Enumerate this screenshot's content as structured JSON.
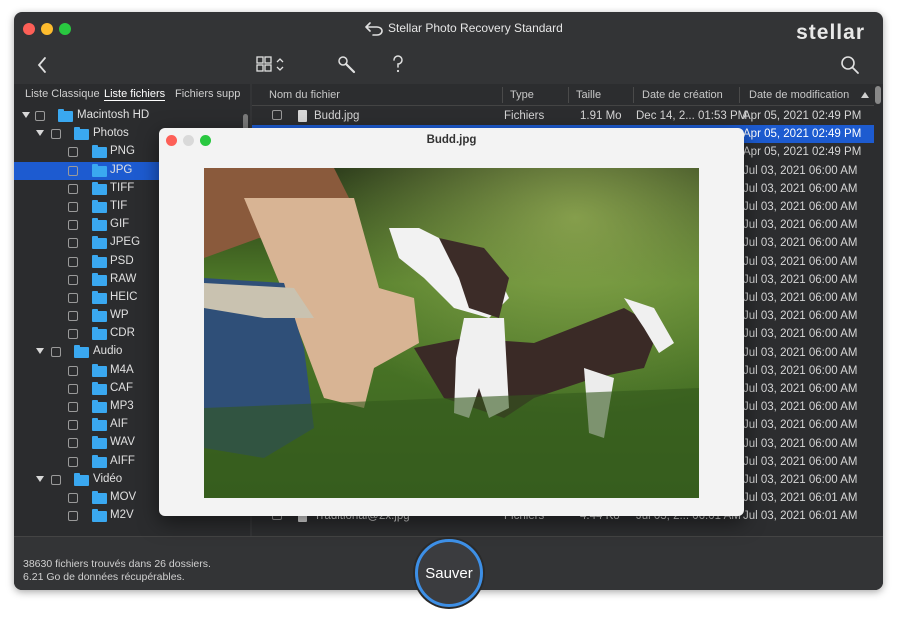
{
  "window": {
    "title": "Stellar Photo Recovery Standard",
    "logo": "stellar"
  },
  "sidebar": {
    "tabs": [
      "Liste Classique",
      "Liste fichiers",
      "Fichiers supp"
    ],
    "active_tab": 1,
    "tree": [
      {
        "label": "Macintosh HD",
        "level": 0,
        "expanded": true
      },
      {
        "label": "Photos",
        "level": 1,
        "expanded": true
      },
      {
        "label": "PNG",
        "level": 2
      },
      {
        "label": "JPG",
        "level": 2,
        "selected": true
      },
      {
        "label": "TIFF",
        "level": 2
      },
      {
        "label": "TIF",
        "level": 2
      },
      {
        "label": "GIF",
        "level": 2
      },
      {
        "label": "JPEG",
        "level": 2
      },
      {
        "label": "PSD",
        "level": 2
      },
      {
        "label": "RAW",
        "level": 2
      },
      {
        "label": "HEIC",
        "level": 2
      },
      {
        "label": "WP",
        "level": 2
      },
      {
        "label": "CDR",
        "level": 2
      },
      {
        "label": "Audio",
        "level": 1,
        "expanded": true
      },
      {
        "label": "M4A",
        "level": 2
      },
      {
        "label": "CAF",
        "level": 2
      },
      {
        "label": "MP3",
        "level": 2
      },
      {
        "label": "AIF",
        "level": 2
      },
      {
        "label": "WAV",
        "level": 2
      },
      {
        "label": "AIFF",
        "level": 2
      },
      {
        "label": "Vidéo",
        "level": 1,
        "expanded": true
      },
      {
        "label": "MOV",
        "level": 2
      },
      {
        "label": "M2V",
        "level": 2
      }
    ]
  },
  "filelist": {
    "headers": {
      "name": "Nom du fichier",
      "type": "Type",
      "size": "Taille",
      "created": "Date de création",
      "modified": "Date de modification"
    },
    "rows": [
      {
        "name": "Budd.jpg",
        "type": "Fichiers",
        "size": "1.91 Mo",
        "created": "Dec 14, 2... 01:53 PM",
        "modified": "Apr 05, 2021 02:49 PM"
      },
      {
        "name": "",
        "type": "",
        "size": "",
        "created": "",
        "modified": "Apr 05, 2021 02:49 PM",
        "selected": true
      },
      {
        "name": "",
        "type": "",
        "size": "",
        "created": "",
        "modified": "Apr 05, 2021 02:49 PM"
      },
      {
        "name": "",
        "type": "",
        "size": "",
        "created": "",
        "modified": "Jul 03, 2021 06:00 AM"
      },
      {
        "name": "",
        "type": "",
        "size": "",
        "created": "",
        "modified": "Jul 03, 2021 06:00 AM"
      },
      {
        "name": "",
        "type": "",
        "size": "",
        "created": "",
        "modified": "Jul 03, 2021 06:00 AM"
      },
      {
        "name": "",
        "type": "",
        "size": "",
        "created": "",
        "modified": "Jul 03, 2021 06:00 AM"
      },
      {
        "name": "",
        "type": "",
        "size": "",
        "created": "",
        "modified": "Jul 03, 2021 06:00 AM"
      },
      {
        "name": "",
        "type": "",
        "size": "",
        "created": "",
        "modified": "Jul 03, 2021 06:00 AM"
      },
      {
        "name": "",
        "type": "",
        "size": "",
        "created": "",
        "modified": "Jul 03, 2021 06:00 AM"
      },
      {
        "name": "",
        "type": "",
        "size": "",
        "created": "",
        "modified": "Jul 03, 2021 06:00 AM"
      },
      {
        "name": "",
        "type": "",
        "size": "",
        "created": "",
        "modified": "Jul 03, 2021 06:00 AM"
      },
      {
        "name": "",
        "type": "",
        "size": "",
        "created": "",
        "modified": "Jul 03, 2021 06:00 AM"
      },
      {
        "name": "",
        "type": "",
        "size": "",
        "created": "",
        "modified": "Jul 03, 2021 06:00 AM"
      },
      {
        "name": "",
        "type": "",
        "size": "",
        "created": "",
        "modified": "Jul 03, 2021 06:00 AM"
      },
      {
        "name": "",
        "type": "",
        "size": "",
        "created": "",
        "modified": "Jul 03, 2021 06:00 AM"
      },
      {
        "name": "",
        "type": "",
        "size": "",
        "created": "",
        "modified": "Jul 03, 2021 06:00 AM"
      },
      {
        "name": "",
        "type": "",
        "size": "",
        "created": "",
        "modified": "Jul 03, 2021 06:00 AM"
      },
      {
        "name": "",
        "type": "",
        "size": "",
        "created": "",
        "modified": "Jul 03, 2021 06:00 AM"
      },
      {
        "name": "",
        "type": "",
        "size": "",
        "created": "",
        "modified": "Jul 03, 2021 06:00 AM"
      },
      {
        "name": "",
        "type": "",
        "size": "",
        "created": "",
        "modified": "Jul 03, 2021 06:00 AM"
      },
      {
        "name": "",
        "type": "",
        "size": "",
        "created": "",
        "modified": "Jul 03, 2021 06:01 AM"
      },
      {
        "name": "Traditional@2x.jpg",
        "type": "Fichiers",
        "size": "4.44 Ko",
        "created": "Jul 03, 2... 06:01 AM",
        "modified": "Jul 03, 2021 06:01 AM"
      }
    ]
  },
  "status": {
    "line1": "38630 fichiers trouvés dans 26 dossiers.",
    "line2": "6.21 Go de données récupérables."
  },
  "save_button": "Sauver",
  "preview": {
    "title": "Budd.jpg"
  },
  "colors": {
    "selection": "#1d5bd0",
    "folder": "#3aa8f0",
    "accent": "#3d8fe6"
  }
}
